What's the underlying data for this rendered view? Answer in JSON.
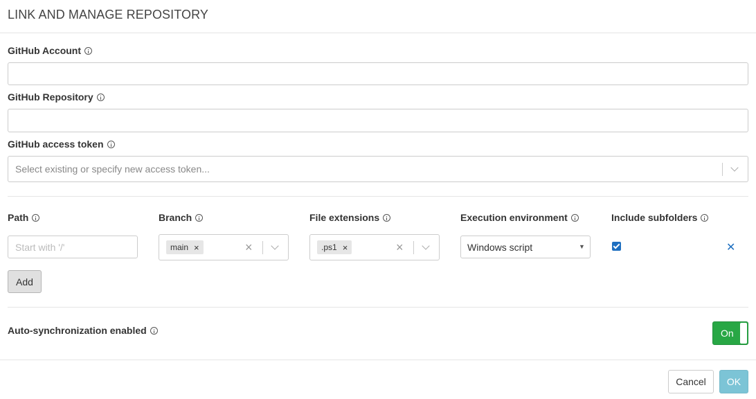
{
  "dialog": {
    "title": "LINK AND MANAGE REPOSITORY"
  },
  "account": {
    "label": "GitHub Account",
    "value": ""
  },
  "repository": {
    "label": "GitHub Repository",
    "value": ""
  },
  "token": {
    "label": "GitHub access token",
    "placeholder": "Select existing or specify new access token..."
  },
  "columns": {
    "path": "Path",
    "branch": "Branch",
    "extensions": "File extensions",
    "environment": "Execution environment",
    "subfolders": "Include subfolders"
  },
  "row": {
    "path_placeholder": "Start with '/'",
    "branch_tag": "main",
    "extension_tag": ".ps1",
    "environment": "Windows script",
    "include_subfolders": true
  },
  "add_label": "Add",
  "autosync": {
    "label": "Auto-synchronization enabled",
    "toggle": "On"
  },
  "footer": {
    "cancel": "Cancel",
    "ok": "OK"
  },
  "colors": {
    "toggle_on": "#28a745",
    "ok_button": "#7cc4d6",
    "remove_icon": "#1e6fc0"
  }
}
